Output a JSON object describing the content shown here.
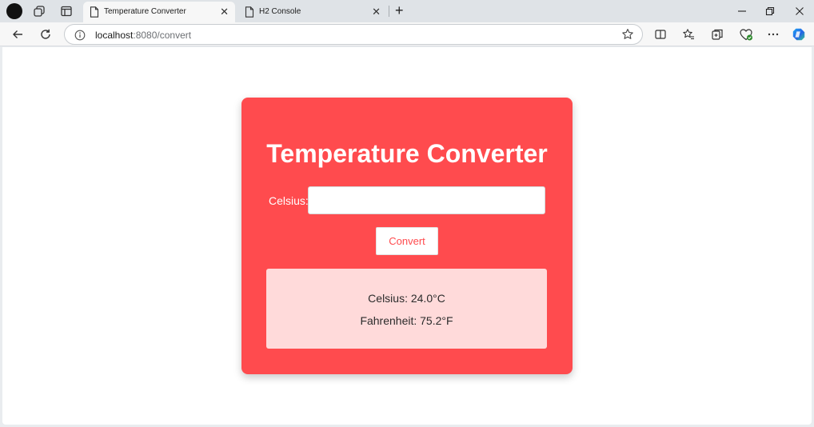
{
  "browser": {
    "tabs": [
      {
        "title": "Temperature Converter",
        "active": true
      },
      {
        "title": "H2 Console",
        "active": false
      }
    ],
    "address": {
      "host": "localhost",
      "rest": ":8080/convert"
    },
    "colors": {
      "titlebar": "#dfe3e7",
      "toolbar": "#f7f7f7"
    }
  },
  "page": {
    "title": "Temperature Converter",
    "celsius_label": "Celsius:",
    "celsius_value": "",
    "convert_label": "Convert",
    "result": {
      "celsius": "Celsius: 24.0°C",
      "fahrenheit": "Fahrenheit: 75.2°F"
    },
    "colors": {
      "card": "#ff4b4e",
      "result_bg": "#ffdada",
      "button_text": "#ff4b4e"
    }
  },
  "icons": [
    "profile-icon",
    "workspaces-icon",
    "vertical-tabs-icon",
    "document-icon",
    "close-icon",
    "new-tab-icon",
    "minimize-icon",
    "restore-icon",
    "back-icon",
    "refresh-icon",
    "info-icon",
    "favorite-star-icon",
    "split-screen-icon",
    "favorites-icon",
    "collections-icon",
    "browser-essentials-icon",
    "more-icon",
    "copilot-icon"
  ]
}
